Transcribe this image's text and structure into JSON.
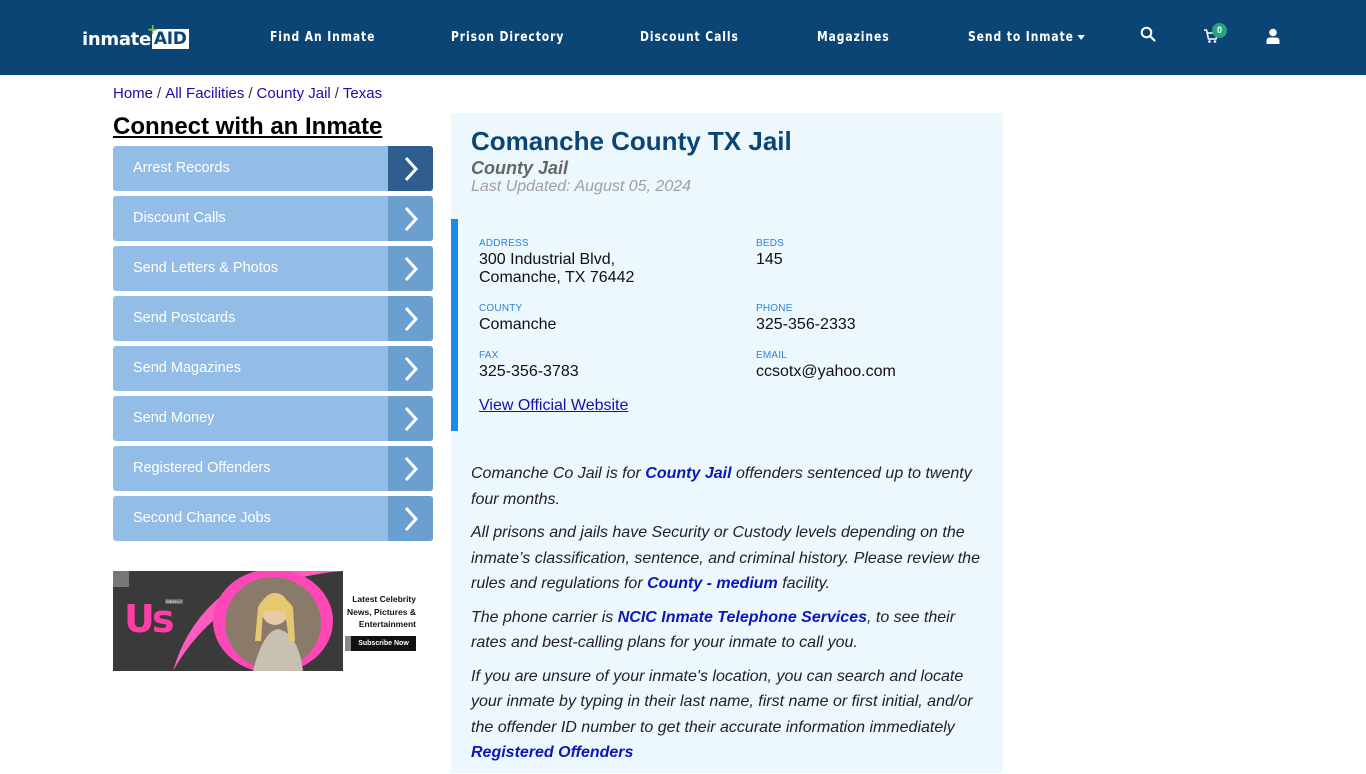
{
  "header": {
    "logo": {
      "text_main": "inmate",
      "text_accent": "AID",
      "plus": "+"
    },
    "nav": [
      {
        "label": "Find An Inmate"
      },
      {
        "label": "Prison Directory"
      },
      {
        "label": "Discount Calls"
      },
      {
        "label": "Magazines"
      },
      {
        "label": "Send to Inmate",
        "has_dropdown": true
      }
    ],
    "cart_count": "0",
    "icons": [
      "search-icon",
      "cart-icon",
      "user-icon"
    ]
  },
  "breadcrumb": [
    {
      "label": "Home"
    },
    {
      "label": "All Facilities"
    },
    {
      "label": "County Jail"
    },
    {
      "label": "Texas"
    }
  ],
  "breadcrumb_separator": "/",
  "sidebar": {
    "title": "Connect with an Inmate",
    "items": [
      {
        "label": "Arrest Records"
      },
      {
        "label": "Discount Calls"
      },
      {
        "label": "Send Letters & Photos"
      },
      {
        "label": "Send Postcards"
      },
      {
        "label": "Send Magazines"
      },
      {
        "label": "Send Money"
      },
      {
        "label": "Registered Offenders"
      },
      {
        "label": "Second Chance Jobs"
      }
    ],
    "ad": {
      "brand": "Us",
      "brand_sub": "WEEKLY",
      "line1": "Latest Celebrity",
      "line2": "News, Pictures &",
      "line3": "Entertainment",
      "cta": "Subscribe Now"
    }
  },
  "facility": {
    "name": "Comanche County TX Jail",
    "type": "County Jail",
    "last_updated": "Last Updated: August 05, 2024",
    "address_label": "ADDRESS",
    "address_line1": "300 Industrial Blvd,",
    "address_line2": "Comanche, TX 76442",
    "beds_label": "BEDS",
    "beds": "145",
    "county_label": "COUNTY",
    "county": "Comanche",
    "phone_label": "PHONE",
    "phone": "325-356-2333",
    "fax_label": "FAX",
    "fax": "325-356-3783",
    "email_label": "EMAIL",
    "email": "ccsotx@yahoo.com",
    "website_link": "View Official Website"
  },
  "description": {
    "p1_pre": "Comanche Co Jail is for ",
    "p1_link": "County Jail",
    "p1_post": " offenders sentenced up to twenty four months.",
    "p2_pre": "All prisons and jails have Security or Custody levels depending on the inmate’s classification, sentence, and criminal history. Please review the rules and regulations for ",
    "p2_link": "County - medium",
    "p2_post": " facility.",
    "p3_pre": "The phone carrier is ",
    "p3_link": "NCIC Inmate Telephone Services",
    "p3_post": ", to see their rates and best-calling plans for your inmate to call you.",
    "p4_text": "If you are unsure of your inmate's location, you can search and locate your inmate by typing in their last name, first name or first initial, and/or the offender ID number to get their accurate information immediately",
    "p4_link": "Registered Offenders"
  },
  "colors": {
    "nav_bg": "#0b4576",
    "accent": "#1c8be8",
    "sidebar_item": "#93bde6",
    "link": "#0b17b8",
    "badge": "#27a37e"
  }
}
